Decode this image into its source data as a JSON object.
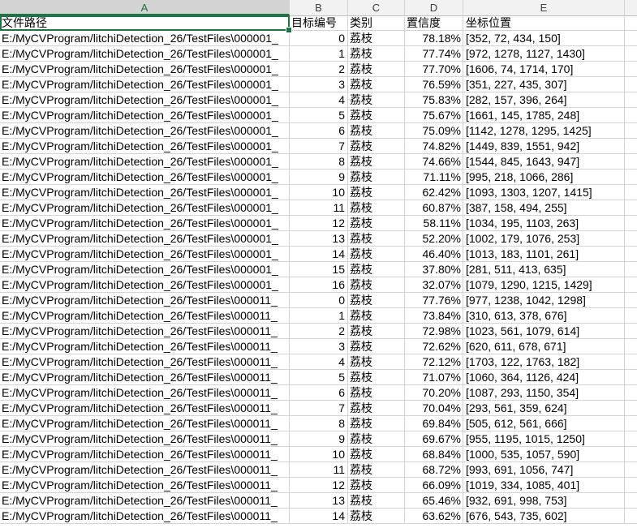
{
  "columns": [
    "A",
    "B",
    "C",
    "D",
    "E"
  ],
  "header_row": {
    "file_path": "文件路径",
    "target_id": "目标编号",
    "category": "类别",
    "confidence": "置信度",
    "position": "坐标位置"
  },
  "rows": [
    {
      "path": "E:/MyCVProgram/litchiDetection_26/TestFiles\\000001_",
      "id": "0",
      "cat": "荔枝",
      "conf": "78.18%",
      "pos": "[352, 72, 434, 150]"
    },
    {
      "path": "E:/MyCVProgram/litchiDetection_26/TestFiles\\000001_",
      "id": "1",
      "cat": "荔枝",
      "conf": "77.74%",
      "pos": "[972, 1278, 1127, 1430]"
    },
    {
      "path": "E:/MyCVProgram/litchiDetection_26/TestFiles\\000001_",
      "id": "2",
      "cat": "荔枝",
      "conf": "77.70%",
      "pos": "[1606, 74, 1714, 170]"
    },
    {
      "path": "E:/MyCVProgram/litchiDetection_26/TestFiles\\000001_",
      "id": "3",
      "cat": "荔枝",
      "conf": "76.59%",
      "pos": "[351, 227, 435, 307]"
    },
    {
      "path": "E:/MyCVProgram/litchiDetection_26/TestFiles\\000001_",
      "id": "4",
      "cat": "荔枝",
      "conf": "75.83%",
      "pos": "[282, 157, 396, 264]"
    },
    {
      "path": "E:/MyCVProgram/litchiDetection_26/TestFiles\\000001_",
      "id": "5",
      "cat": "荔枝",
      "conf": "75.67%",
      "pos": "[1661, 145, 1785, 248]"
    },
    {
      "path": "E:/MyCVProgram/litchiDetection_26/TestFiles\\000001_",
      "id": "6",
      "cat": "荔枝",
      "conf": "75.09%",
      "pos": "[1142, 1278, 1295, 1425]"
    },
    {
      "path": "E:/MyCVProgram/litchiDetection_26/TestFiles\\000001_",
      "id": "7",
      "cat": "荔枝",
      "conf": "74.82%",
      "pos": "[1449, 839, 1551, 942]"
    },
    {
      "path": "E:/MyCVProgram/litchiDetection_26/TestFiles\\000001_",
      "id": "8",
      "cat": "荔枝",
      "conf": "74.66%",
      "pos": "[1544, 845, 1643, 947]"
    },
    {
      "path": "E:/MyCVProgram/litchiDetection_26/TestFiles\\000001_",
      "id": "9",
      "cat": "荔枝",
      "conf": "71.11%",
      "pos": "[995, 218, 1066, 286]"
    },
    {
      "path": "E:/MyCVProgram/litchiDetection_26/TestFiles\\000001_",
      "id": "10",
      "cat": "荔枝",
      "conf": "62.42%",
      "pos": "[1093, 1303, 1207, 1415]"
    },
    {
      "path": "E:/MyCVProgram/litchiDetection_26/TestFiles\\000001_",
      "id": "11",
      "cat": "荔枝",
      "conf": "60.87%",
      "pos": "[387, 158, 494, 255]"
    },
    {
      "path": "E:/MyCVProgram/litchiDetection_26/TestFiles\\000001_",
      "id": "12",
      "cat": "荔枝",
      "conf": "58.11%",
      "pos": "[1034, 195, 1103, 263]"
    },
    {
      "path": "E:/MyCVProgram/litchiDetection_26/TestFiles\\000001_",
      "id": "13",
      "cat": "荔枝",
      "conf": "52.20%",
      "pos": "[1002, 179, 1076, 253]"
    },
    {
      "path": "E:/MyCVProgram/litchiDetection_26/TestFiles\\000001_",
      "id": "14",
      "cat": "荔枝",
      "conf": "46.40%",
      "pos": "[1013, 183, 1101, 261]"
    },
    {
      "path": "E:/MyCVProgram/litchiDetection_26/TestFiles\\000001_",
      "id": "15",
      "cat": "荔枝",
      "conf": "37.80%",
      "pos": "[281, 511, 413, 635]"
    },
    {
      "path": "E:/MyCVProgram/litchiDetection_26/TestFiles\\000001_",
      "id": "16",
      "cat": "荔枝",
      "conf": "32.07%",
      "pos": "[1079, 1290, 1215, 1429]"
    },
    {
      "path": "E:/MyCVProgram/litchiDetection_26/TestFiles\\000011_",
      "id": "0",
      "cat": "荔枝",
      "conf": "77.76%",
      "pos": "[977, 1238, 1042, 1298]"
    },
    {
      "path": "E:/MyCVProgram/litchiDetection_26/TestFiles\\000011_",
      "id": "1",
      "cat": "荔枝",
      "conf": "73.84%",
      "pos": "[310, 613, 378, 676]"
    },
    {
      "path": "E:/MyCVProgram/litchiDetection_26/TestFiles\\000011_",
      "id": "2",
      "cat": "荔枝",
      "conf": "72.98%",
      "pos": "[1023, 561, 1079, 614]"
    },
    {
      "path": "E:/MyCVProgram/litchiDetection_26/TestFiles\\000011_",
      "id": "3",
      "cat": "荔枝",
      "conf": "72.62%",
      "pos": "[620, 611, 678, 671]"
    },
    {
      "path": "E:/MyCVProgram/litchiDetection_26/TestFiles\\000011_",
      "id": "4",
      "cat": "荔枝",
      "conf": "72.12%",
      "pos": "[1703, 122, 1763, 182]"
    },
    {
      "path": "E:/MyCVProgram/litchiDetection_26/TestFiles\\000011_",
      "id": "5",
      "cat": "荔枝",
      "conf": "71.07%",
      "pos": "[1060, 364, 1126, 424]"
    },
    {
      "path": "E:/MyCVProgram/litchiDetection_26/TestFiles\\000011_",
      "id": "6",
      "cat": "荔枝",
      "conf": "70.20%",
      "pos": "[1087, 293, 1150, 354]"
    },
    {
      "path": "E:/MyCVProgram/litchiDetection_26/TestFiles\\000011_",
      "id": "7",
      "cat": "荔枝",
      "conf": "70.04%",
      "pos": "[293, 561, 359, 624]"
    },
    {
      "path": "E:/MyCVProgram/litchiDetection_26/TestFiles\\000011_",
      "id": "8",
      "cat": "荔枝",
      "conf": "69.84%",
      "pos": "[505, 612, 561, 666]"
    },
    {
      "path": "E:/MyCVProgram/litchiDetection_26/TestFiles\\000011_",
      "id": "9",
      "cat": "荔枝",
      "conf": "69.67%",
      "pos": "[955, 1195, 1015, 1250]"
    },
    {
      "path": "E:/MyCVProgram/litchiDetection_26/TestFiles\\000011_",
      "id": "10",
      "cat": "荔枝",
      "conf": "68.84%",
      "pos": "[1000, 535, 1057, 590]"
    },
    {
      "path": "E:/MyCVProgram/litchiDetection_26/TestFiles\\000011_",
      "id": "11",
      "cat": "荔枝",
      "conf": "68.72%",
      "pos": "[993, 691, 1056, 747]"
    },
    {
      "path": "E:/MyCVProgram/litchiDetection_26/TestFiles\\000011_",
      "id": "12",
      "cat": "荔枝",
      "conf": "66.09%",
      "pos": "[1019, 334, 1085, 401]"
    },
    {
      "path": "E:/MyCVProgram/litchiDetection_26/TestFiles\\000011_",
      "id": "13",
      "cat": "荔枝",
      "conf": "65.46%",
      "pos": "[932, 691, 998, 753]"
    },
    {
      "path": "E:/MyCVProgram/litchiDetection_26/TestFiles\\000011_",
      "id": "14",
      "cat": "荔枝",
      "conf": "63.62%",
      "pos": "[676, 543, 735, 602]"
    }
  ],
  "colors": {
    "selection": "#217346",
    "header_bg": "#f2f2f2",
    "gridline": "#d4d4d4"
  }
}
